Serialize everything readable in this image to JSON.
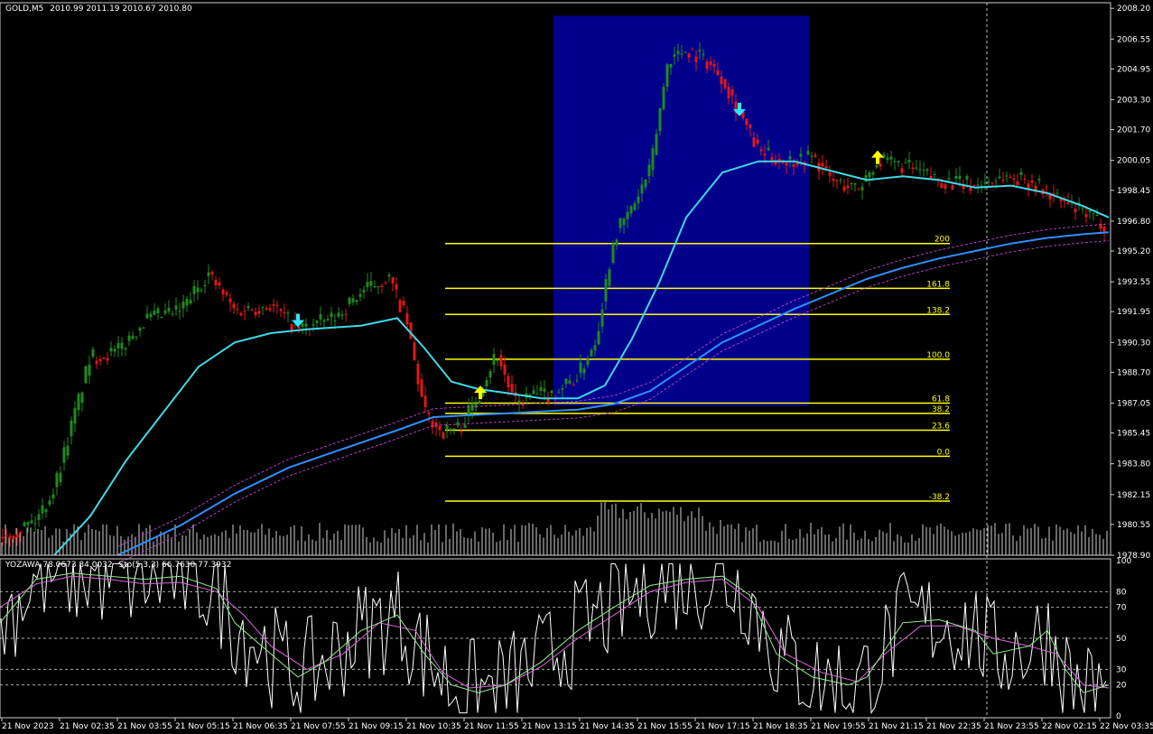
{
  "header": {
    "symbol": "GOLD,M5",
    "ohlc": "2010.99 2011.19 2010.67 2010.80"
  },
  "subwindow": {
    "indicator_label": "YOZAWA 78.0673 84.0032",
    "stoch_label": "Sto(5,3,3) 66.7630 77.3932"
  },
  "colors": {
    "background": "#000000",
    "bull": "#1f8a1f",
    "bear": "#e01818",
    "ma_fast": "#3fd9e6",
    "ma_slow": "#2f8fff",
    "fib": "#ffff00",
    "box": "#00008b",
    "volume": "#d0d0d0",
    "arrow_up": "#ffff00",
    "arrow_down": "#2fe6ff",
    "stoch_main": "#90ee90",
    "stoch_signal": "#dd66dd",
    "osc": "#ffffff"
  },
  "chart_data": [
    {
      "type": "candlestick",
      "title": "GOLD,M5",
      "ylim": [
        1978.9,
        2008.5
      ],
      "y_ticks": [
        "2008.20",
        "2006.55",
        "2004.95",
        "2003.30",
        "2001.70",
        "2000.05",
        "1998.45",
        "1996.80",
        "1995.20",
        "1993.55",
        "1991.95",
        "1990.30",
        "1988.70",
        "1987.05",
        "1985.45",
        "1983.80",
        "1982.15",
        "1980.55",
        "1978.90"
      ],
      "x_ticks": [
        "21 Nov 2023",
        "21 Nov 02:35",
        "21 Nov 03:55",
        "21 Nov 05:15",
        "21 Nov 06:35",
        "21 Nov 07:55",
        "21 Nov 09:15",
        "21 Nov 10:35",
        "21 Nov 11:55",
        "21 Nov 13:15",
        "21 Nov 14:35",
        "21 Nov 15:55",
        "21 Nov 17:15",
        "21 Nov 18:35",
        "21 Nov 19:55",
        "21 Nov 21:15",
        "21 Nov 22:35",
        "21 Nov 23:55",
        "22 Nov 02:15",
        "22 Nov 03:35"
      ],
      "price_path": [
        [
          0,
          1980.0
        ],
        [
          20,
          1980.3
        ],
        [
          40,
          1980.8
        ],
        [
          60,
          1982.5
        ],
        [
          80,
          1986.0
        ],
        [
          100,
          1989.5
        ],
        [
          130,
          1989.8
        ],
        [
          160,
          1991.5
        ],
        [
          200,
          1992.0
        ],
        [
          230,
          1994.0
        ],
        [
          260,
          1992.0
        ],
        [
          300,
          1992.3
        ],
        [
          330,
          1991.0
        ],
        [
          370,
          1991.6
        ],
        [
          400,
          1993.0
        ],
        [
          430,
          1993.8
        ],
        [
          450,
          1991.5
        ],
        [
          470,
          1986.5
        ],
        [
          490,
          1985.5
        ],
        [
          510,
          1985.8
        ],
        [
          530,
          1987.5
        ],
        [
          550,
          1989.8
        ],
        [
          570,
          1987.0
        ],
        [
          590,
          1987.5
        ],
        [
          610,
          1987.5
        ],
        [
          640,
          1988.5
        ],
        [
          660,
          1990.5
        ],
        [
          680,
          1996.0
        ],
        [
          700,
          1997.5
        ],
        [
          720,
          1999.5
        ],
        [
          740,
          2005.5
        ],
        [
          760,
          2006.0
        ],
        [
          780,
          2005.5
        ],
        [
          800,
          2004.5
        ],
        [
          820,
          2002.5
        ],
        [
          840,
          2000.5
        ],
        [
          870,
          2000.0
        ],
        [
          900,
          2000.3
        ],
        [
          920,
          1999.0
        ],
        [
          950,
          1998.5
        ],
        [
          970,
          2000.0
        ],
        [
          1000,
          1999.8
        ],
        [
          1040,
          1999.0
        ],
        [
          1080,
          1998.7
        ],
        [
          1110,
          1999.2
        ],
        [
          1140,
          1999.0
        ],
        [
          1170,
          1998.0
        ],
        [
          1200,
          1997.2
        ],
        [
          1228,
          1996.5
        ]
      ],
      "ma_fast": [
        [
          60,
          1978.9
        ],
        [
          100,
          1981.0
        ],
        [
          140,
          1984.0
        ],
        [
          180,
          1986.5
        ],
        [
          220,
          1989.0
        ],
        [
          260,
          1990.3
        ],
        [
          300,
          1990.8
        ],
        [
          340,
          1991.0
        ],
        [
          400,
          1991.2
        ],
        [
          440,
          1991.6
        ],
        [
          470,
          1990.0
        ],
        [
          500,
          1988.2
        ],
        [
          530,
          1987.8
        ],
        [
          560,
          1987.6
        ],
        [
          600,
          1987.3
        ],
        [
          640,
          1987.3
        ],
        [
          670,
          1988.0
        ],
        [
          700,
          1990.5
        ],
        [
          730,
          1993.5
        ],
        [
          760,
          1997.0
        ],
        [
          800,
          1999.4
        ],
        [
          840,
          2000.0
        ],
        [
          880,
          2000.0
        ],
        [
          920,
          1999.5
        ],
        [
          960,
          1999.0
        ],
        [
          1000,
          1999.2
        ],
        [
          1040,
          1999.0
        ],
        [
          1080,
          1998.6
        ],
        [
          1120,
          1998.7
        ],
        [
          1160,
          1998.3
        ],
        [
          1200,
          1997.6
        ],
        [
          1228,
          1997.0
        ]
      ],
      "ma_slow": [
        [
          130,
          1978.9
        ],
        [
          200,
          1980.5
        ],
        [
          260,
          1982.2
        ],
        [
          320,
          1983.6
        ],
        [
          380,
          1984.6
        ],
        [
          440,
          1985.6
        ],
        [
          480,
          1986.3
        ],
        [
          520,
          1986.4
        ],
        [
          560,
          1986.5
        ],
        [
          600,
          1986.6
        ],
        [
          640,
          1986.7
        ],
        [
          680,
          1987.0
        ],
        [
          720,
          1987.7
        ],
        [
          760,
          1989.0
        ],
        [
          800,
          1990.3
        ],
        [
          840,
          1991.2
        ],
        [
          880,
          1992.1
        ],
        [
          920,
          1992.9
        ],
        [
          960,
          1993.7
        ],
        [
          1000,
          1994.3
        ],
        [
          1040,
          1994.8
        ],
        [
          1080,
          1995.2
        ],
        [
          1120,
          1995.6
        ],
        [
          1160,
          1995.9
        ],
        [
          1200,
          1996.1
        ],
        [
          1228,
          1996.2
        ]
      ],
      "fib_levels": [
        {
          "label": "200",
          "price": 1995.6
        },
        {
          "label": "161.8",
          "price": 1993.2
        },
        {
          "label": "138.2",
          "price": 1991.8
        },
        {
          "label": "100.0",
          "price": 1989.4
        },
        {
          "label": "61.8",
          "price": 1987.05
        },
        {
          "label": "38.2",
          "price": 1986.5
        },
        {
          "label": "23.6",
          "price": 1985.6
        },
        {
          "label": "0.0",
          "price": 1984.2
        },
        {
          "label": "-38.2",
          "price": 1981.8
        }
      ],
      "highlight_box": {
        "from": "21 Nov 13:15",
        "to": "21 Nov 18:35",
        "price_top": 2007.8,
        "price_bottom": 1986.9
      },
      "signals": [
        {
          "type": "sell",
          "price": 1991.5
        },
        {
          "type": "buy",
          "price": 1987.6
        },
        {
          "type": "sell",
          "price": 2002.8
        },
        {
          "type": "buy",
          "price": 2000.2
        }
      ]
    },
    {
      "type": "line",
      "title": "YOZAWA / Sto(5,3,3)",
      "ylim": [
        0,
        100
      ],
      "y_ticks": [
        "100",
        "80",
        "70",
        "50",
        "30",
        "20",
        "0"
      ],
      "levels": [
        80,
        70,
        50,
        30,
        20
      ],
      "stoch_main": [
        [
          0,
          60
        ],
        [
          40,
          88
        ],
        [
          80,
          92
        ],
        [
          120,
          90
        ],
        [
          160,
          88
        ],
        [
          200,
          90
        ],
        [
          240,
          82
        ],
        [
          260,
          60
        ],
        [
          300,
          40
        ],
        [
          330,
          25
        ],
        [
          360,
          35
        ],
        [
          400,
          55
        ],
        [
          440,
          65
        ],
        [
          470,
          40
        ],
        [
          500,
          20
        ],
        [
          530,
          15
        ],
        [
          560,
          20
        ],
        [
          600,
          35
        ],
        [
          640,
          55
        ],
        [
          680,
          70
        ],
        [
          720,
          84
        ],
        [
          760,
          88
        ],
        [
          800,
          90
        ],
        [
          830,
          78
        ],
        [
          860,
          40
        ],
        [
          900,
          25
        ],
        [
          940,
          20
        ],
        [
          960,
          25
        ],
        [
          1000,
          60
        ],
        [
          1040,
          62
        ],
        [
          1080,
          55
        ],
        [
          1100,
          40
        ],
        [
          1140,
          45
        ],
        [
          1160,
          55
        ],
        [
          1180,
          30
        ],
        [
          1200,
          15
        ],
        [
          1228,
          20
        ]
      ],
      "stoch_signal": [
        [
          0,
          70
        ],
        [
          40,
          85
        ],
        [
          80,
          90
        ],
        [
          120,
          88
        ],
        [
          160,
          85
        ],
        [
          200,
          86
        ],
        [
          240,
          80
        ],
        [
          270,
          65
        ],
        [
          300,
          45
        ],
        [
          340,
          30
        ],
        [
          380,
          40
        ],
        [
          420,
          60
        ],
        [
          460,
          55
        ],
        [
          490,
          28
        ],
        [
          520,
          18
        ],
        [
          560,
          20
        ],
        [
          600,
          32
        ],
        [
          640,
          50
        ],
        [
          680,
          65
        ],
        [
          720,
          80
        ],
        [
          760,
          86
        ],
        [
          800,
          88
        ],
        [
          840,
          70
        ],
        [
          870,
          40
        ],
        [
          910,
          28
        ],
        [
          950,
          22
        ],
        [
          980,
          40
        ],
        [
          1020,
          58
        ],
        [
          1060,
          58
        ],
        [
          1100,
          50
        ],
        [
          1140,
          45
        ],
        [
          1170,
          40
        ],
        [
          1200,
          20
        ],
        [
          1228,
          18
        ]
      ]
    }
  ]
}
